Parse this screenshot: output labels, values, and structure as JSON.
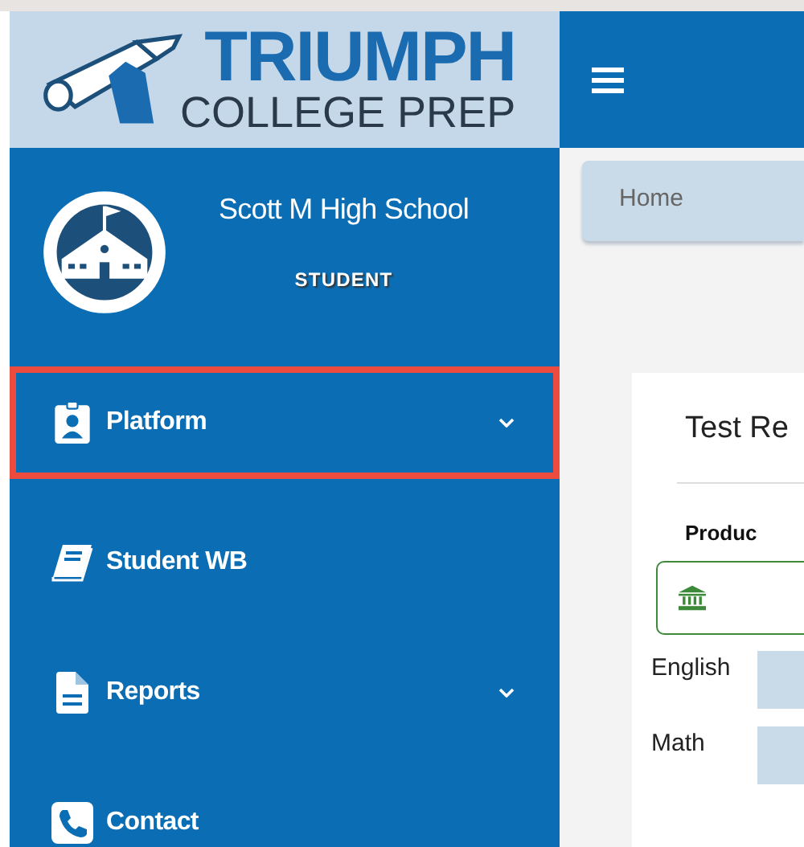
{
  "logo": {
    "title": "TRIUMPH",
    "subtitle": "COLLEGE PREP"
  },
  "profile": {
    "school": "Scott M High School",
    "role": "STUDENT"
  },
  "nav": [
    {
      "label": "Platform",
      "kind": "badge",
      "has_submenu": true,
      "highlighted": true
    },
    {
      "label": "Student WB",
      "kind": "book",
      "has_submenu": false,
      "highlighted": false
    },
    {
      "label": "Reports",
      "kind": "file",
      "has_submenu": true,
      "highlighted": false
    },
    {
      "label": "Contact",
      "kind": "phone",
      "has_submenu": false,
      "highlighted": false
    }
  ],
  "breadcrumb": [
    "Home"
  ],
  "card": {
    "title": "Test Re",
    "section": "Produc",
    "subjects": [
      "English",
      "Math"
    ]
  }
}
